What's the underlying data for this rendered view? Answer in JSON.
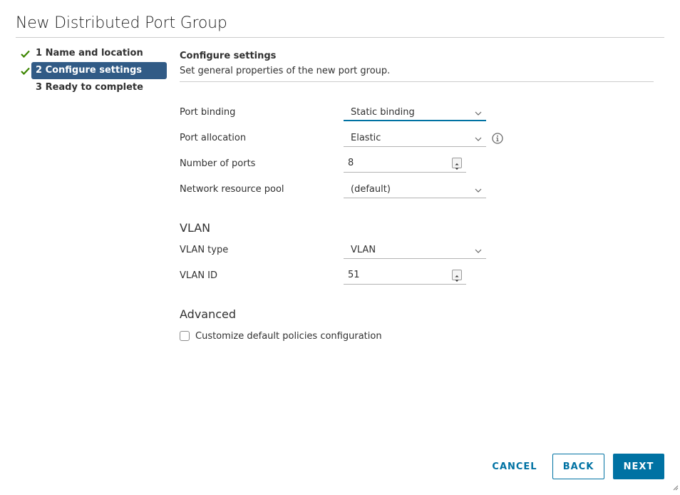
{
  "dialog": {
    "title": "New Distributed Port Group"
  },
  "steps": [
    {
      "label": "1 Name and location",
      "completed": true,
      "active": false
    },
    {
      "label": "2 Configure settings",
      "completed": true,
      "active": true
    },
    {
      "label": "3 Ready to complete",
      "completed": false,
      "active": false
    }
  ],
  "section": {
    "heading": "Configure settings",
    "description": "Set general properties of the new port group."
  },
  "form": {
    "port_binding": {
      "label": "Port binding",
      "value": "Static binding"
    },
    "port_allocation": {
      "label": "Port allocation",
      "value": "Elastic"
    },
    "number_of_ports": {
      "label": "Number of ports",
      "value": "8"
    },
    "network_resource_pool": {
      "label": "Network resource pool",
      "value": "(default)"
    }
  },
  "vlan": {
    "heading": "VLAN",
    "type": {
      "label": "VLAN type",
      "value": "VLAN"
    },
    "id": {
      "label": "VLAN ID",
      "value": "51"
    }
  },
  "advanced": {
    "heading": "Advanced",
    "customize_label": "Customize default policies configuration",
    "customize_checked": false
  },
  "footer": {
    "cancel_label": "CANCEL",
    "back_label": "BACK",
    "next_label": "NEXT"
  },
  "colors": {
    "accent": "#0072a3",
    "active_step_bg": "#315b86",
    "check_green": "#3c8500"
  },
  "icons": {
    "step_check": "check-icon",
    "select_caret": "chevron-down-icon",
    "info": "info-icon",
    "resize": "resize-grip-icon"
  }
}
